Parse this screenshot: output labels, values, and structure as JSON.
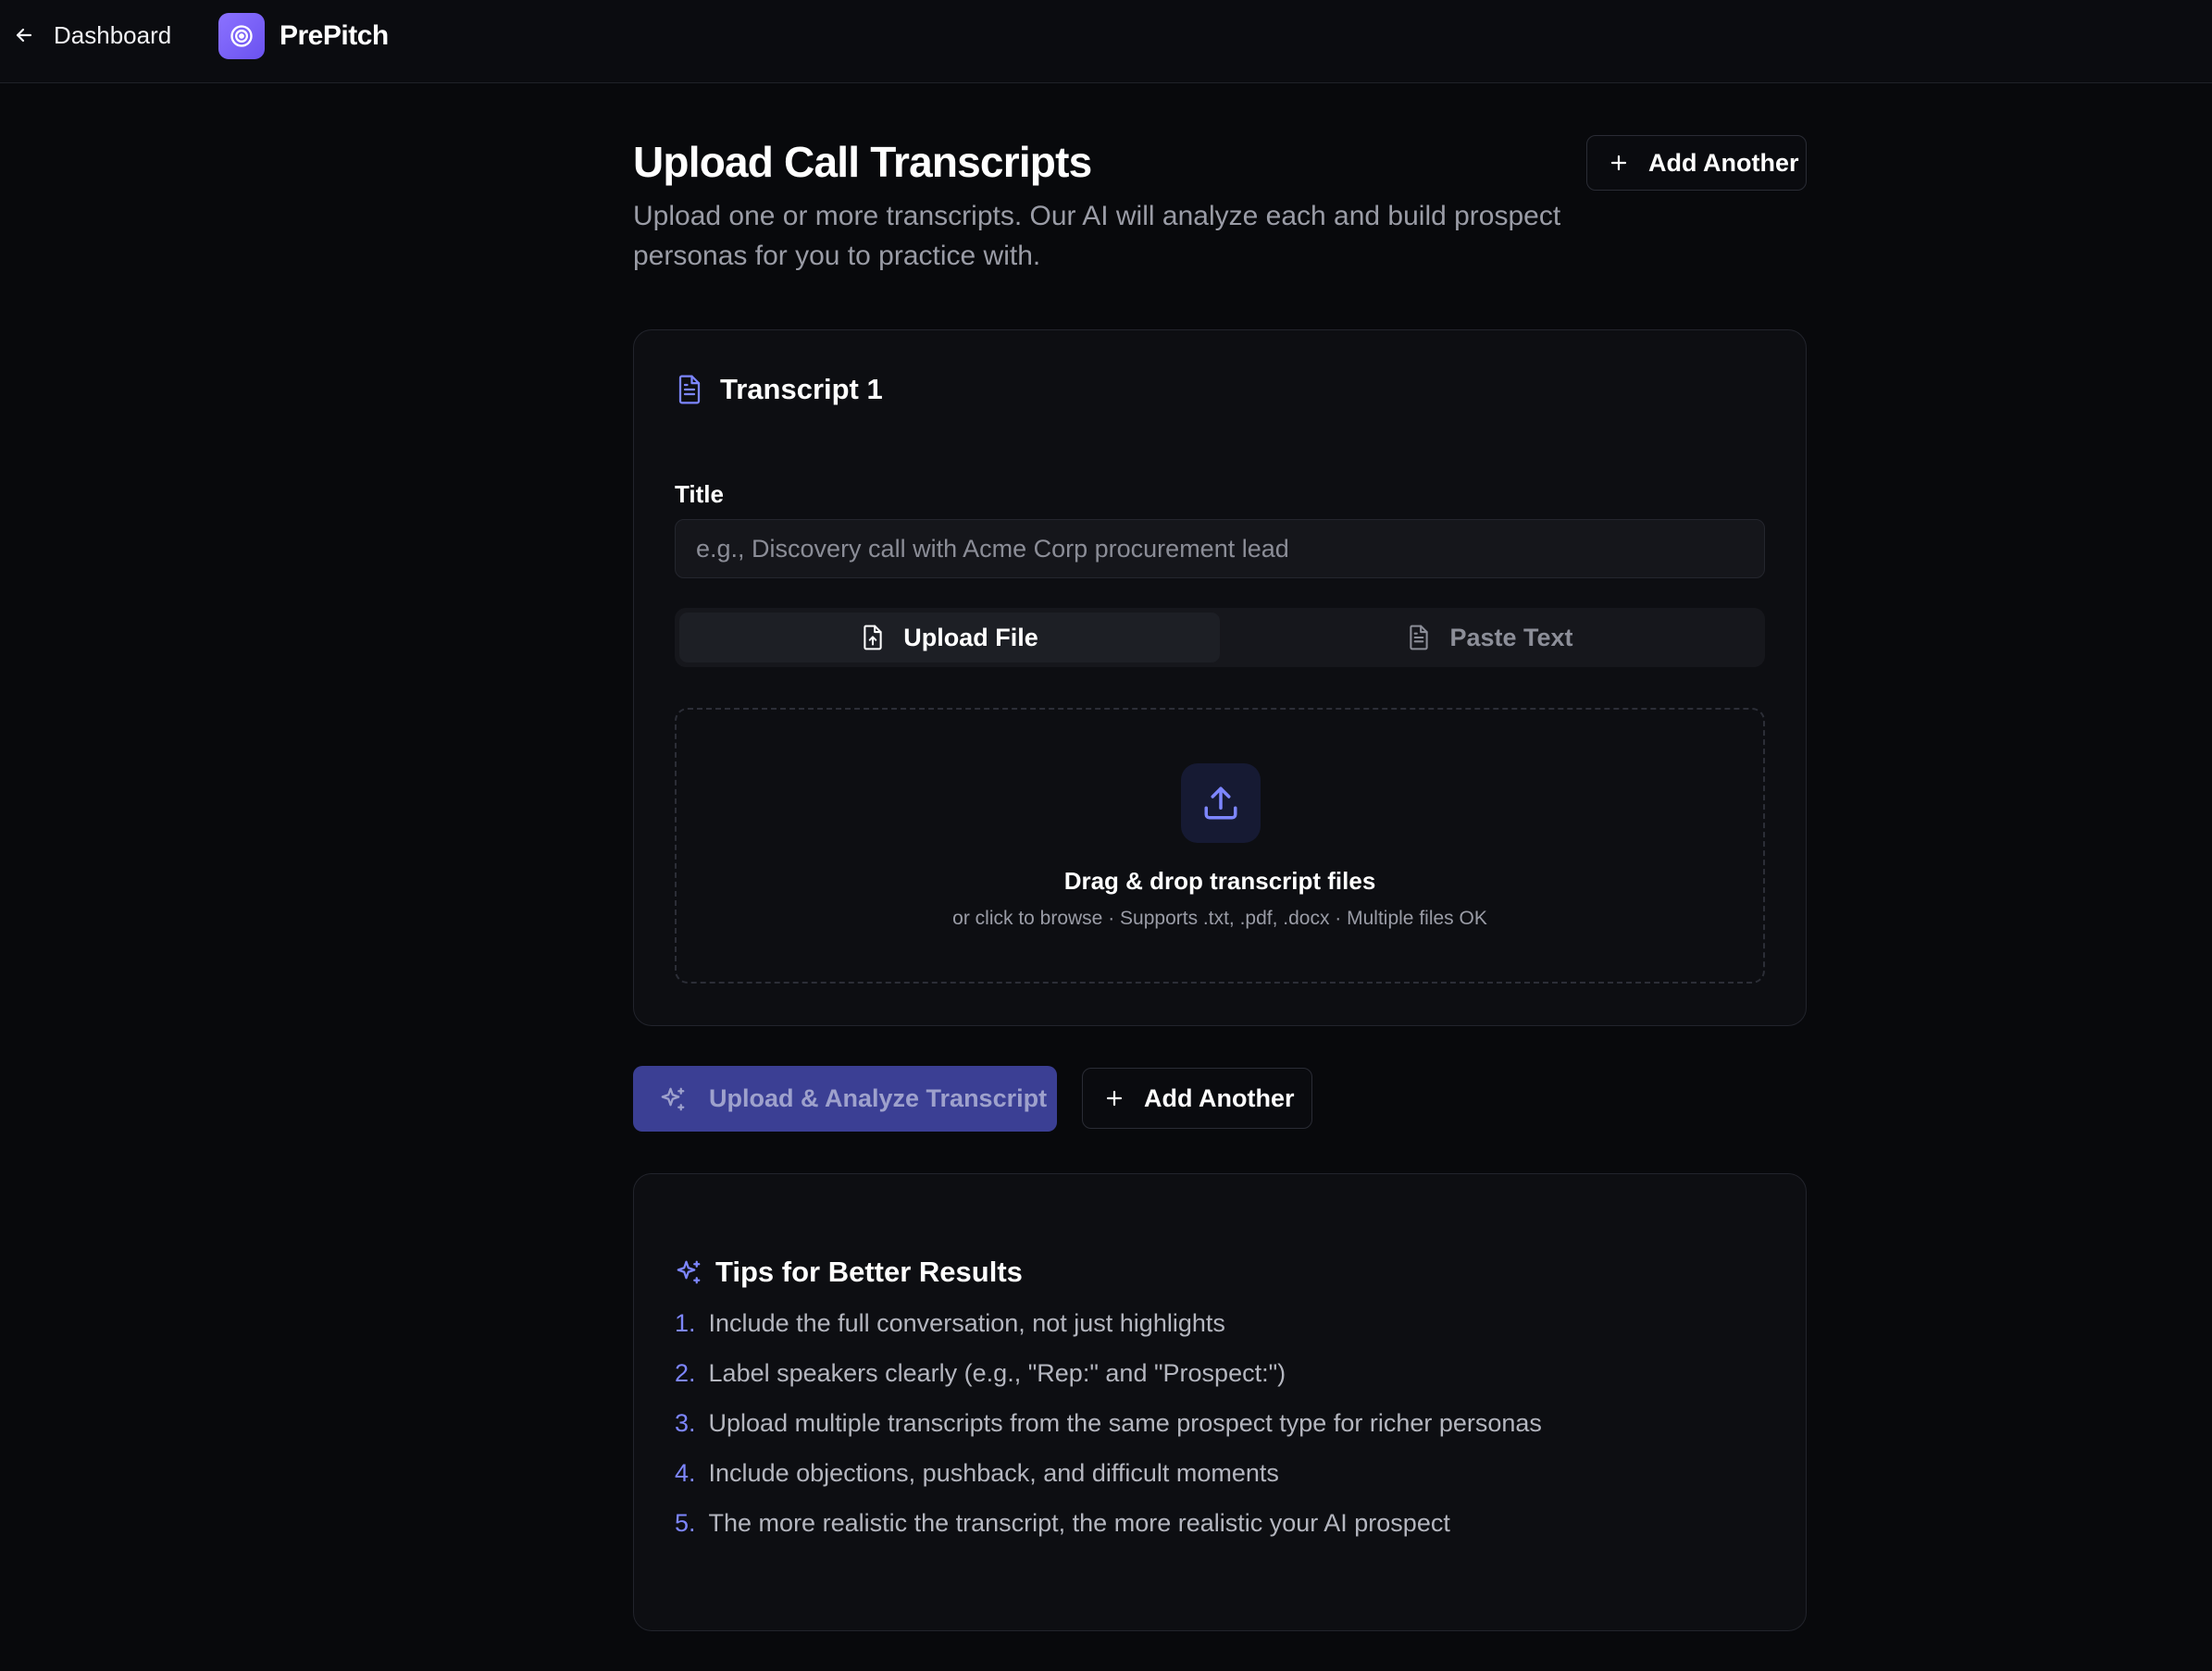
{
  "nav": {
    "back_label": "Dashboard",
    "brand_name": "PrePitch"
  },
  "header": {
    "title": "Upload Call Transcripts",
    "subtitle": "Upload one or more transcripts. Our AI will analyze each and build prospect personas for you to practice with.",
    "add_another_label": "Add Another"
  },
  "transcript_card": {
    "heading": "Transcript 1",
    "title_label": "Title",
    "title_value": "",
    "title_placeholder": "e.g., Discovery call with Acme Corp procurement lead",
    "tabs": [
      {
        "label": "Upload File",
        "icon": "file-upload-icon",
        "active": true
      },
      {
        "label": "Paste Text",
        "icon": "file-text-icon",
        "active": false
      }
    ],
    "dropzone": {
      "icon": "upload-icon",
      "title": "Drag & drop transcript files",
      "subtitle": "or click to browse · Supports .txt, .pdf, .docx · Multiple files OK"
    }
  },
  "actions": {
    "primary_label": "Upload & Analyze Transcript",
    "secondary_label": "Add Another"
  },
  "tips": {
    "heading": "Tips for Better Results",
    "items": [
      {
        "num": "1.",
        "text": "Include the full conversation, not just highlights"
      },
      {
        "num": "2.",
        "text": "Label speakers clearly (e.g., \"Rep:\" and \"Prospect:\")"
      },
      {
        "num": "3.",
        "text": "Upload multiple transcripts from the same prospect type for richer personas"
      },
      {
        "num": "4.",
        "text": "Include objections, pushback, and difficult moments"
      },
      {
        "num": "5.",
        "text": "The more realistic the transcript, the more realistic your AI prospect"
      }
    ]
  },
  "colors": {
    "background": "#08090c",
    "card": "#0d0e12",
    "accent": "#7d86ff",
    "brand": "#7b62fa",
    "primary_button": "#3b3f94"
  }
}
